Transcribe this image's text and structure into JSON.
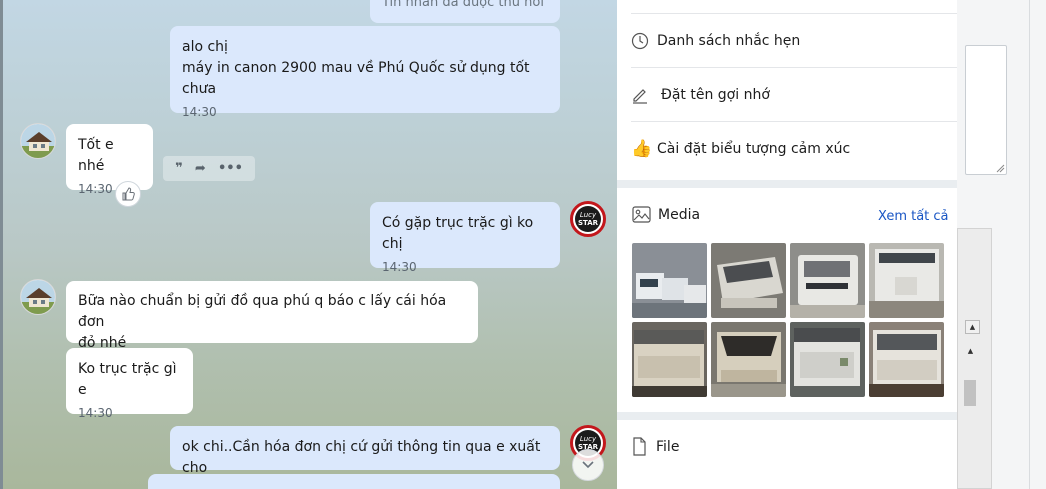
{
  "chat": {
    "messages": [
      {
        "id": "m0",
        "direction": "out",
        "lines": [
          "Tin nhắn đã được thu hồi"
        ],
        "time": ""
      },
      {
        "id": "m1",
        "direction": "out",
        "lines": [
          "alo chị",
          "máy in canon 2900 mau  về Phú Quốc sử dụng tốt chưa"
        ],
        "time": "14:30"
      },
      {
        "id": "m2",
        "direction": "in",
        "lines": [
          "Tốt e nhé"
        ],
        "time": "14:30"
      },
      {
        "id": "m3",
        "direction": "out",
        "lines": [
          "Có gặp trục trặc gì ko chị"
        ],
        "time": "14:30"
      },
      {
        "id": "m4",
        "direction": "in",
        "lines": [
          "Bữa nào chuẩn bị gửi đồ qua phú q báo c lấy cái hóa đơn",
          "đỏ nhé"
        ],
        "time": ""
      },
      {
        "id": "m5",
        "direction": "in",
        "lines": [
          "Ko trục trặc gì e"
        ],
        "time": "14:30"
      },
      {
        "id": "m6",
        "direction": "out",
        "lines": [
          "ok chi..Cần hóa đơn chị cứ gửi thông tin qua e xuất cho"
        ],
        "time": ""
      }
    ],
    "avatar_brand_top": "Lucy",
    "avatar_brand_bottom": "STAR",
    "icons": {
      "quote": "quote-icon",
      "share": "share-icon",
      "more": "more-icon",
      "like": "thumbs-up-icon",
      "scroll_down": "chevron-down-icon"
    }
  },
  "panel": {
    "menu": [
      {
        "label": "Danh sách nhắc hẹn",
        "icon": "clock-icon"
      },
      {
        "label": "Đặt tên gợi nhớ",
        "icon": "pencil-icon"
      },
      {
        "label": "Cài đặt biểu tượng cảm xúc",
        "icon": "thumbs-up-emoji-icon"
      }
    ],
    "media": {
      "title": "Media",
      "see_all": "Xem tất cả",
      "icon": "image-icon",
      "thumb_count": 8
    },
    "file": {
      "title": "File",
      "icon": "file-icon"
    }
  },
  "colors": {
    "bubble_out": "#dbe8fc",
    "bubble_in": "#ffffff",
    "link": "#1a56c4",
    "brand_red": "#c3171c"
  }
}
